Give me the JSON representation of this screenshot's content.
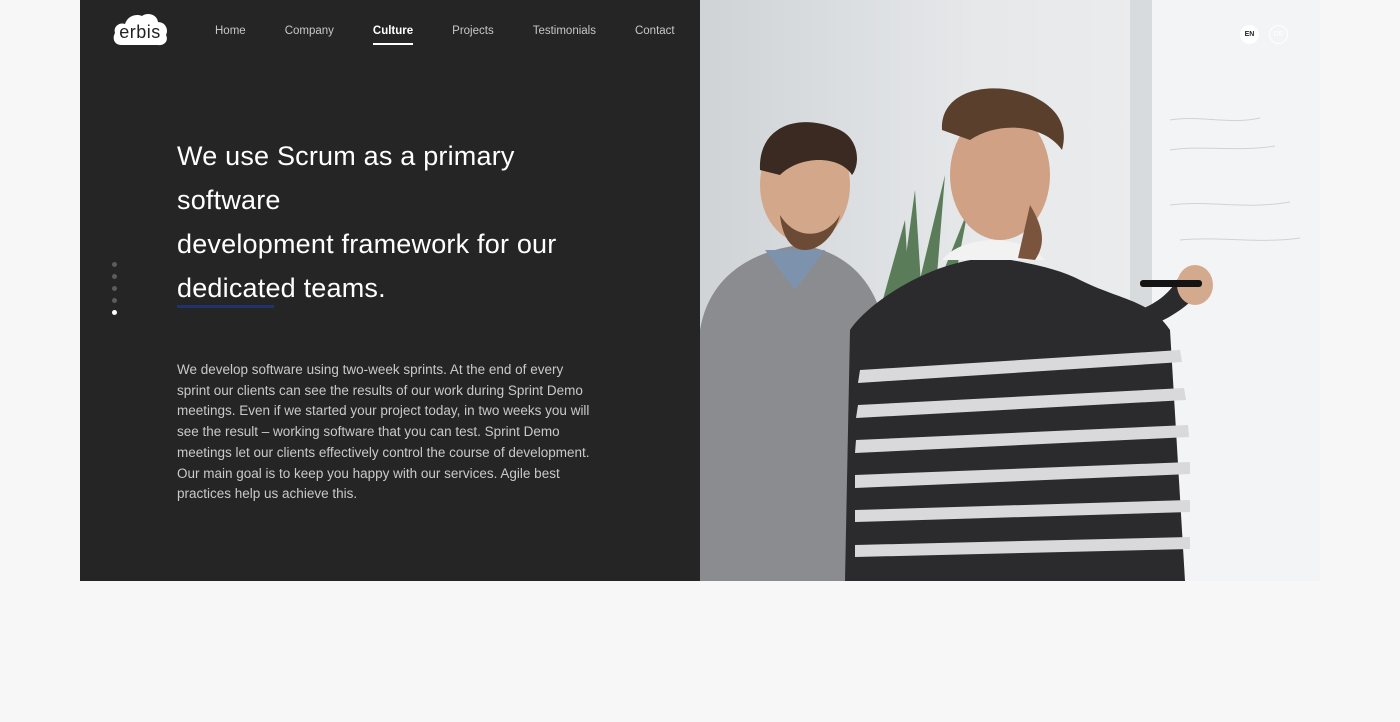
{
  "brand": {
    "logo_text": "erbis"
  },
  "nav": {
    "items": [
      {
        "label": "Home",
        "active": false
      },
      {
        "label": "Company",
        "active": false
      },
      {
        "label": "Culture",
        "active": true
      },
      {
        "label": "Projects",
        "active": false
      },
      {
        "label": "Testimonials",
        "active": false
      },
      {
        "label": "Contact",
        "active": false
      }
    ]
  },
  "hero": {
    "headline_lines": [
      "We use Scrum as a primary software",
      "development framework for our",
      "dedicated teams."
    ],
    "body": "We develop software using two-week sprints. At the end of every sprint our clients can see the results of our work during Sprint Demo meetings. Even if we started your project today, in two weeks you will see the result – working software that you can test. Sprint Demo meetings let our clients effectively control the course of development. Our main goal is to keep you happy with our services. Agile best practices help us achieve this.",
    "slide_count": 5,
    "active_slide": 5
  },
  "language": {
    "options": [
      {
        "label": "EN",
        "active": true
      },
      {
        "label": "DE",
        "active": false
      }
    ]
  },
  "colors": {
    "panel_dark": "#252526",
    "accent_blue": "#22336b",
    "page_bg": "#f7f7f7"
  },
  "icons": {
    "logo": "cloud-logo-icon"
  }
}
